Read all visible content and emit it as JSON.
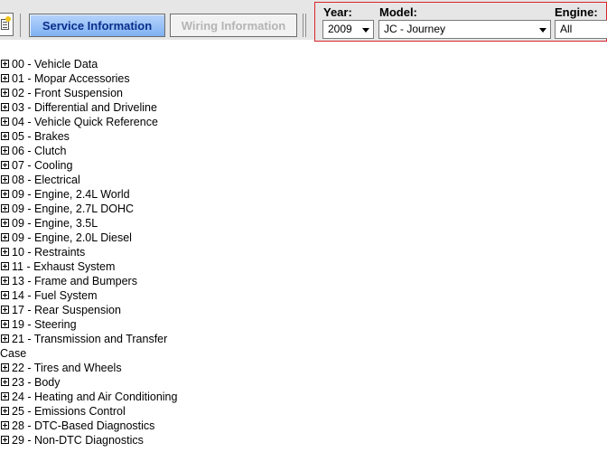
{
  "tabs": {
    "service": "Service Information",
    "wiring": "Wiring Information"
  },
  "selector": {
    "year_label": "Year:",
    "year_value": "2009",
    "model_label": "Model:",
    "model_value": "JC - Journey",
    "engine_label": "Engine:",
    "engine_value": "All"
  },
  "toc": {
    "items": [
      "00 - Vehicle Data",
      "01 - Mopar Accessories",
      "02 - Front Suspension",
      "03 - Differential and Driveline",
      "04 - Vehicle Quick Reference",
      "05 - Brakes",
      "06 - Clutch",
      "07 - Cooling",
      "08 - Electrical",
      "09 - Engine, 2.4L World",
      "09 - Engine, 2.7L DOHC",
      "09 - Engine, 3.5L",
      "09 - Engine, 2.0L Diesel",
      "10 - Restraints",
      "11 - Exhaust System",
      "13 - Frame and Bumpers",
      "14 - Fuel System",
      "17 - Rear Suspension",
      "19 - Steering",
      "21 - Transmission and Transfer",
      "22 - Tires and Wheels",
      "23 - Body",
      "24 - Heating and Air Conditioning",
      "25 - Emissions Control",
      "28 - DTC-Based Diagnostics",
      "29 - Non-DTC Diagnostics"
    ],
    "wrap_21": "Case"
  }
}
